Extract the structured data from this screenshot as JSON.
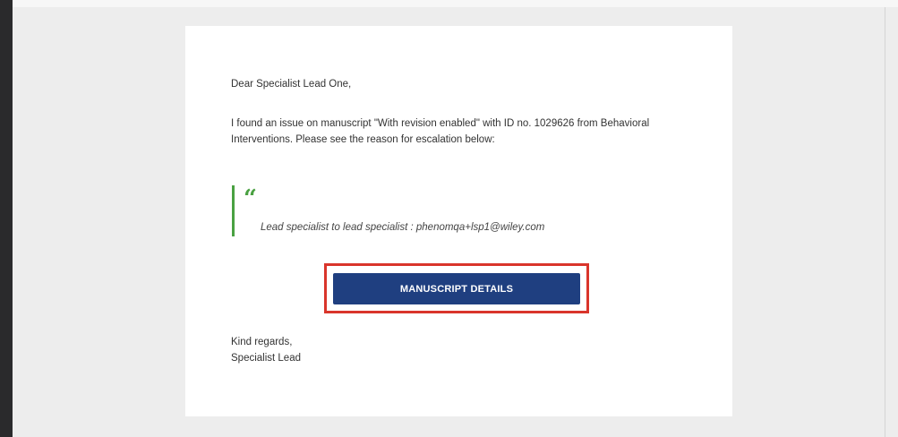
{
  "email": {
    "greeting": "Dear Specialist Lead One,",
    "body": "I found an issue on manuscript \"With revision enabled\" with ID no. 1029626 from Behavioral Interventions. Please see the reason for escalation below:",
    "quote_mark": "“",
    "quote_text": "Lead specialist to lead specialist : phenomqa+lsp1@wiley.com",
    "button_label": "MANUSCRIPT DETAILS",
    "signoff": "Kind regards,",
    "signature": "Specialist Lead"
  },
  "colors": {
    "page_background": "#ededed",
    "card_background": "#ffffff",
    "quote_accent": "#4aa142",
    "button_background": "#1f3f80",
    "highlight_outline": "#d9352b",
    "left_bar": "#2a2a2c"
  }
}
